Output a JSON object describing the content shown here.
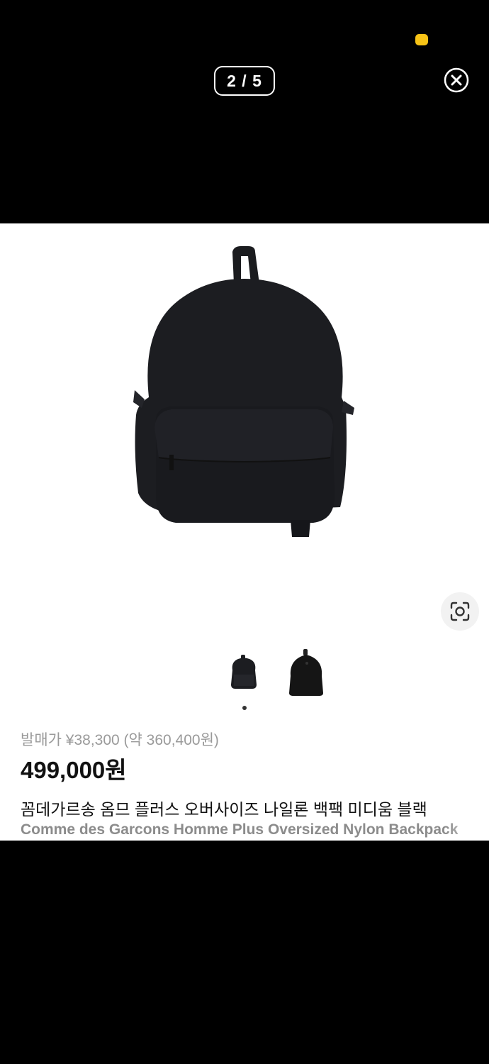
{
  "viewer": {
    "page_indicator": "2 / 5"
  },
  "product": {
    "image_alt": "black nylon backpack",
    "release_price": "발매가 ¥38,300 (약 360,400원)",
    "price": "499,000원",
    "title_ko": "꼼데가르송 옴므 플러스 오버사이즈 나일론 백팩 미디움 블랙",
    "title_en": "Comme des Garcons Homme Plus Oversized Nylon Backpack"
  },
  "colors": {
    "accent_dot": "#f7c316",
    "background": "#000000",
    "sheet": "#ffffff"
  },
  "icons": [
    "close-icon",
    "lens-search-icon"
  ]
}
